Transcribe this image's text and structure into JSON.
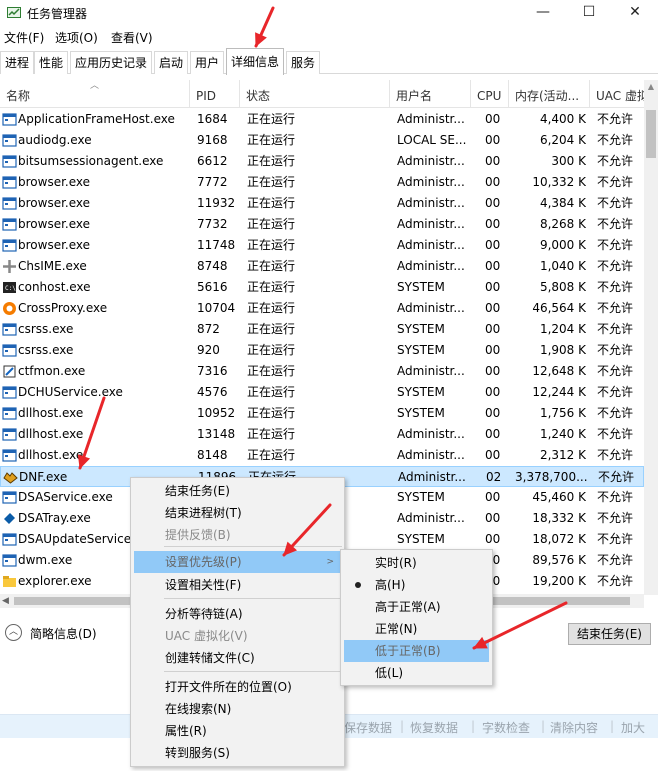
{
  "window": {
    "title": "任务管理器",
    "minimize": "—",
    "maximize": "☐",
    "close": "✕"
  },
  "menubar": [
    "文件(F)",
    "选项(O)",
    "查看(V)"
  ],
  "tabs": [
    "进程",
    "性能",
    "应用历史记录",
    "启动",
    "用户",
    "详细信息",
    "服务"
  ],
  "active_tab": "详细信息",
  "columns": [
    "名称",
    "PID",
    "状态",
    "用户名",
    "CPU",
    "内存(活动...",
    "UAC 虚拟"
  ],
  "rows": [
    {
      "name": "ApplicationFrameHost.exe",
      "pid": "1684",
      "status": "正在运行",
      "user": "Administr...",
      "cpu": "00",
      "mem": "4,400 K",
      "uac": "不允许"
    },
    {
      "name": "audiodg.exe",
      "pid": "9168",
      "status": "正在运行",
      "user": "LOCAL SE...",
      "cpu": "00",
      "mem": "6,204 K",
      "uac": "不允许"
    },
    {
      "name": "bitsumsessionagent.exe",
      "pid": "6612",
      "status": "正在运行",
      "user": "Administr...",
      "cpu": "00",
      "mem": "300 K",
      "uac": "不允许"
    },
    {
      "name": "browser.exe",
      "pid": "7772",
      "status": "正在运行",
      "user": "Administr...",
      "cpu": "00",
      "mem": "10,332 K",
      "uac": "不允许"
    },
    {
      "name": "browser.exe",
      "pid": "11932",
      "status": "正在运行",
      "user": "Administr...",
      "cpu": "00",
      "mem": "4,384 K",
      "uac": "不允许"
    },
    {
      "name": "browser.exe",
      "pid": "7732",
      "status": "正在运行",
      "user": "Administr...",
      "cpu": "00",
      "mem": "8,268 K",
      "uac": "不允许"
    },
    {
      "name": "browser.exe",
      "pid": "11748",
      "status": "正在运行",
      "user": "Administr...",
      "cpu": "00",
      "mem": "9,000 K",
      "uac": "不允许"
    },
    {
      "name": "ChsIME.exe",
      "pid": "8748",
      "status": "正在运行",
      "user": "Administr...",
      "cpu": "00",
      "mem": "1,040 K",
      "uac": "不允许"
    },
    {
      "name": "conhost.exe",
      "pid": "5616",
      "status": "正在运行",
      "user": "SYSTEM",
      "cpu": "00",
      "mem": "5,808 K",
      "uac": "不允许"
    },
    {
      "name": "CrossProxy.exe",
      "pid": "10704",
      "status": "正在运行",
      "user": "Administr...",
      "cpu": "00",
      "mem": "46,564 K",
      "uac": "不允许"
    },
    {
      "name": "csrss.exe",
      "pid": "872",
      "status": "正在运行",
      "user": "SYSTEM",
      "cpu": "00",
      "mem": "1,204 K",
      "uac": "不允许"
    },
    {
      "name": "csrss.exe",
      "pid": "920",
      "status": "正在运行",
      "user": "SYSTEM",
      "cpu": "00",
      "mem": "1,908 K",
      "uac": "不允许"
    },
    {
      "name": "ctfmon.exe",
      "pid": "7316",
      "status": "正在运行",
      "user": "Administr...",
      "cpu": "00",
      "mem": "12,648 K",
      "uac": "不允许"
    },
    {
      "name": "DCHUService.exe",
      "pid": "4576",
      "status": "正在运行",
      "user": "SYSTEM",
      "cpu": "00",
      "mem": "12,244 K",
      "uac": "不允许"
    },
    {
      "name": "dllhost.exe",
      "pid": "10952",
      "status": "正在运行",
      "user": "SYSTEM",
      "cpu": "00",
      "mem": "1,756 K",
      "uac": "不允许"
    },
    {
      "name": "dllhost.exe",
      "pid": "13148",
      "status": "正在运行",
      "user": "Administr...",
      "cpu": "00",
      "mem": "1,240 K",
      "uac": "不允许"
    },
    {
      "name": "dllhost.exe",
      "pid": "8148",
      "status": "正在运行",
      "user": "Administr...",
      "cpu": "00",
      "mem": "2,312 K",
      "uac": "不允许"
    },
    {
      "name": "DNF.exe",
      "pid": "11896",
      "status": "正在运行",
      "user": "Administr...",
      "cpu": "02",
      "mem": "3,378,700...",
      "uac": "不允许"
    },
    {
      "name": "DSAService.exe",
      "pid": "",
      "status": "",
      "user": "SYSTEM",
      "cpu": "00",
      "mem": "45,460 K",
      "uac": "不允许"
    },
    {
      "name": "DSATray.exe",
      "pid": "",
      "status": "",
      "user": "Administr...",
      "cpu": "00",
      "mem": "18,332 K",
      "uac": "不允许"
    },
    {
      "name": "DSAUpdateService...",
      "pid": "",
      "status": "",
      "user": "SYSTEM",
      "cpu": "00",
      "mem": "18,072 K",
      "uac": "不允许"
    },
    {
      "name": "dwm.exe",
      "pid": "",
      "status": "",
      "user": "",
      "cpu": "00",
      "mem": "89,576 K",
      "uac": "不允许"
    },
    {
      "name": "explorer.exe",
      "pid": "",
      "status": "",
      "user": "",
      "cpu": "00",
      "mem": "19,200 K",
      "uac": "不允许"
    }
  ],
  "footer": {
    "fewer_details": "简略信息(D)",
    "end_task": "结束任务(E)"
  },
  "bottom_strip": [
    "保存数据",
    "恢复数据",
    "字数检查",
    "清除内容",
    "加大"
  ],
  "context_menu": [
    {
      "label": "结束任务(E)"
    },
    {
      "label": "结束进程树(T)"
    },
    {
      "label": "提供反馈(B)",
      "disabled": true
    },
    {
      "label": "设置优先级(P)",
      "submenu": true,
      "highlighted": true
    },
    {
      "label": "设置相关性(F)"
    },
    {
      "label": "分析等待链(A)"
    },
    {
      "label": "UAC 虚拟化(V)",
      "disabled": true
    },
    {
      "label": "创建转储文件(C)"
    },
    {
      "label": "打开文件所在的位置(O)"
    },
    {
      "label": "在线搜索(N)"
    },
    {
      "label": "属性(R)"
    },
    {
      "label": "转到服务(S)"
    }
  ],
  "priority_submenu": [
    {
      "label": "实时(R)"
    },
    {
      "label": "高(H)",
      "checked": true
    },
    {
      "label": "高于正常(A)"
    },
    {
      "label": "正常(N)"
    },
    {
      "label": "低于正常(B)",
      "highlighted": true
    },
    {
      "label": "低(L)"
    }
  ],
  "colors": {
    "selection": "#cce8ff",
    "menu_highlight": "#91c9f7",
    "annotation_arrow": "#e8262a"
  }
}
